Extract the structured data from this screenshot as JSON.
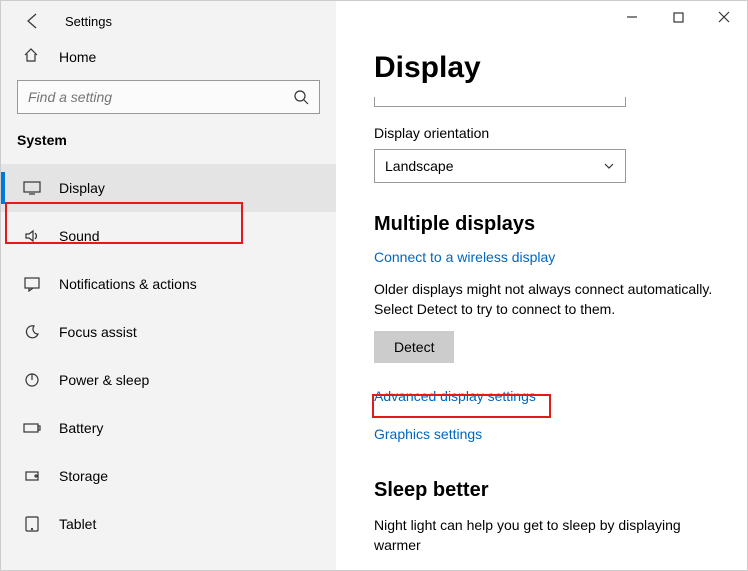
{
  "window": {
    "title": "Settings"
  },
  "sidebar": {
    "home_label": "Home",
    "search_placeholder": "Find a setting",
    "category": "System",
    "items": [
      {
        "label": "Display",
        "icon": "monitor-icon"
      },
      {
        "label": "Sound",
        "icon": "speaker-icon"
      },
      {
        "label": "Notifications & actions",
        "icon": "chat-icon"
      },
      {
        "label": "Focus assist",
        "icon": "moon-icon"
      },
      {
        "label": "Power & sleep",
        "icon": "power-icon"
      },
      {
        "label": "Battery",
        "icon": "battery-icon"
      },
      {
        "label": "Storage",
        "icon": "storage-icon"
      },
      {
        "label": "Tablet",
        "icon": "tablet-icon"
      }
    ]
  },
  "main": {
    "title": "Display",
    "orientation_label": "Display orientation",
    "orientation_value": "Landscape",
    "multiple_heading": "Multiple displays",
    "wireless_link": "Connect to a wireless display",
    "detect_info": "Older displays might not always connect automatically. Select Detect to try to connect to them.",
    "detect_button": "Detect",
    "advanced_link": "Advanced display settings",
    "graphics_link": "Graphics settings",
    "sleep_heading": "Sleep better",
    "sleep_info": "Night light can help you get to sleep by displaying warmer"
  }
}
